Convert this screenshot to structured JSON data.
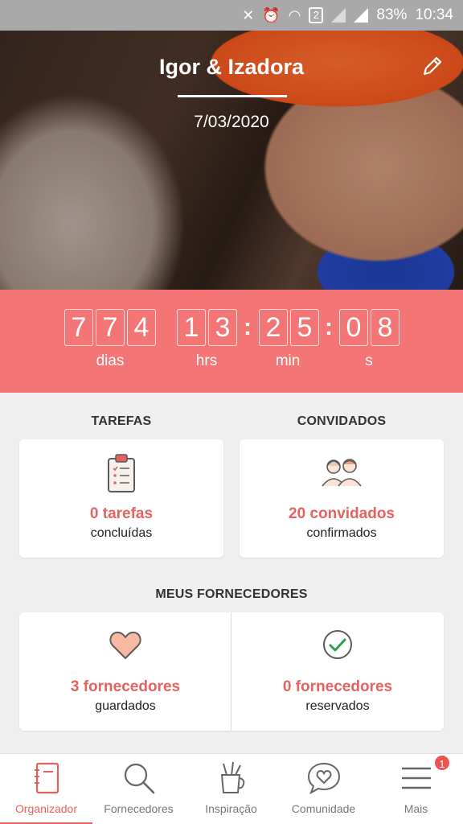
{
  "status_bar": {
    "battery": "83%",
    "time": "10:34",
    "sim": "2"
  },
  "hero": {
    "names": "Igor & Izadora",
    "date": "7/03/2020"
  },
  "countdown": {
    "days": [
      "7",
      "7",
      "4"
    ],
    "hours": [
      "1",
      "3"
    ],
    "minutes": [
      "2",
      "5"
    ],
    "seconds": [
      "0",
      "8"
    ],
    "labels": {
      "days": "dias",
      "hours": "hrs",
      "minutes": "min",
      "seconds": "s"
    },
    "separator": ":"
  },
  "tasks": {
    "title": "TAREFAS",
    "count": "0 tarefas",
    "sub": "concluídas"
  },
  "guests": {
    "title": "CONVIDADOS",
    "count": "20 convidados",
    "sub": "confirmados"
  },
  "vendors": {
    "title": "MEUS FORNECEDORES",
    "saved": {
      "count": "3 fornecedores",
      "sub": "guardados"
    },
    "booked": {
      "count": "0 fornecedores",
      "sub": "reservados"
    }
  },
  "nav": {
    "items": [
      {
        "label": "Organizador",
        "icon": "notebook-icon",
        "active": true
      },
      {
        "label": "Fornecedores",
        "icon": "search-icon"
      },
      {
        "label": "Inspiração",
        "icon": "cup-pencils-icon"
      },
      {
        "label": "Comunidade",
        "icon": "chat-heart-icon"
      },
      {
        "label": "Mais",
        "icon": "menu-icon"
      }
    ],
    "badge": "1"
  },
  "colors": {
    "accent": "#f47575",
    "accent_text": "#e5625f",
    "background": "#efefef"
  }
}
